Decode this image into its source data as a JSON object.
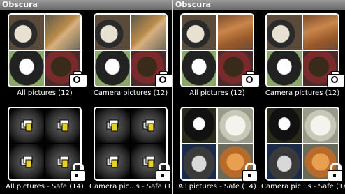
{
  "panels": [
    {
      "title": "Obscura",
      "albums": [
        {
          "caption": "All pictures (12)",
          "style": "photos",
          "thumbs": [
            "cats-icon",
            "dog-icon",
            "dog-icon",
            "dog-icon"
          ],
          "badge": "camera-icon"
        },
        {
          "caption": "Camera pictures (12)",
          "style": "photos",
          "thumbs": [
            "cats-icon",
            "dog-icon",
            "dog-icon",
            "dog-icon"
          ],
          "badge": "camera-icon"
        },
        {
          "caption": "All pictures - Safe (14)",
          "style": "locked",
          "thumbs": [
            "lock-image-icon",
            "lock-image-icon",
            "lock-image-icon",
            "lock-image-icon"
          ],
          "badge": "lock-icon"
        },
        {
          "caption": "Camera pic...s - Safe (14)",
          "style": "locked",
          "thumbs": [
            "lock-image-icon",
            "lock-image-icon",
            "lock-image-icon",
            "lock-image-icon"
          ],
          "badge": "lock-icon"
        }
      ]
    },
    {
      "title": "Obscura",
      "albums": [
        {
          "caption": "All pictures (12)",
          "style": "photos",
          "thumbs": [
            "cats-icon",
            "dog-icon",
            "dog-icon",
            "dog-icon"
          ],
          "badge": "camera-icon"
        },
        {
          "caption": "Camera pictures (12)",
          "style": "photos",
          "thumbs": [
            "cats-icon",
            "dog-icon",
            "dog-icon",
            "dog-icon"
          ],
          "badge": "camera-icon"
        },
        {
          "caption": "All pictures - Safe (14)",
          "style": "cats",
          "thumbs": [
            "cat-icon",
            "cat-icon",
            "cat-icon",
            "cat-icon"
          ],
          "badge": "lock-icon"
        },
        {
          "caption": "Camera pic...s - Safe (14)",
          "style": "cats",
          "thumbs": [
            "cat-icon",
            "cat-icon",
            "cat-icon",
            "cat-icon"
          ],
          "badge": "lock-icon"
        }
      ]
    }
  ]
}
